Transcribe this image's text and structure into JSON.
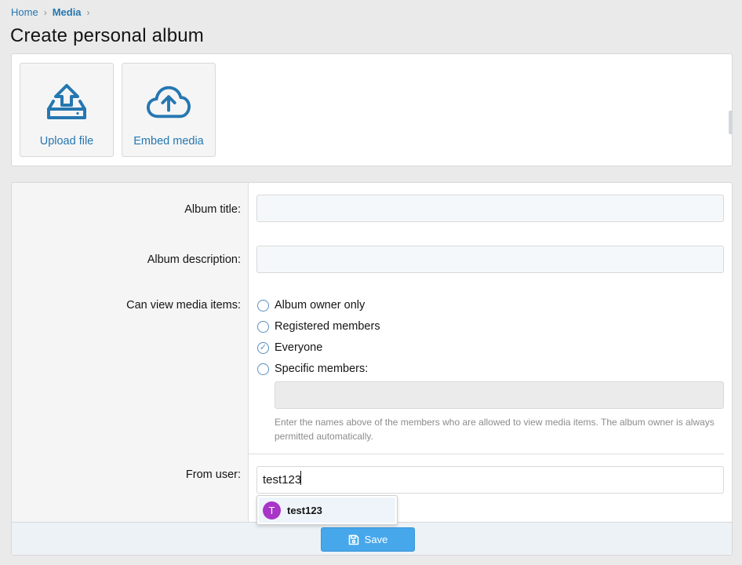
{
  "breadcrumb": {
    "items": [
      "Home",
      "Media"
    ]
  },
  "page_title": "Create personal album",
  "attachments": {
    "upload_label": "Upload file",
    "embed_label": "Embed media"
  },
  "form": {
    "album_title": {
      "label": "Album title:",
      "value": "",
      "placeholder": ""
    },
    "album_description": {
      "label": "Album description:",
      "value": "",
      "placeholder": ""
    },
    "can_view": {
      "label": "Can view media items:",
      "options": [
        "Album owner only",
        "Registered members",
        "Everyone",
        "Specific members:"
      ],
      "selected": "Everyone"
    },
    "hint": "Enter the names above of the members who are allowed to view media items. The album owner is always permitted automatically.",
    "from_user": {
      "label": "From user:",
      "value": "test123"
    },
    "suggestion": {
      "initial": "T",
      "name": "test123"
    }
  },
  "save_label": "Save",
  "colors": {
    "accent": "#2577b1",
    "button": "#47a7eb",
    "avatar": "#a834c8"
  }
}
